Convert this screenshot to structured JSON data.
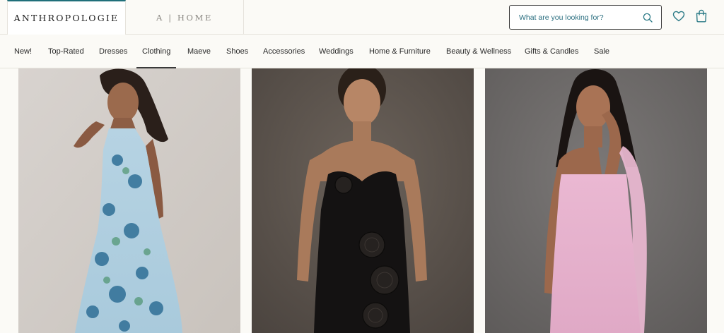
{
  "header": {
    "brand": "ANTHROPOLOGIE",
    "home_tab": "A | HOME",
    "search_placeholder": "What are you looking for?",
    "accent_color": "#1f6f7a"
  },
  "nav": {
    "items": [
      {
        "label": "New!"
      },
      {
        "label": "Top-Rated"
      },
      {
        "label": "Dresses"
      },
      {
        "label": "Clothing"
      },
      {
        "label": "Maeve"
      },
      {
        "label": "Shoes"
      },
      {
        "label": "Accessories"
      },
      {
        "label": "Weddings"
      },
      {
        "label": "Home & Furniture"
      },
      {
        "label": "Beauty & Wellness"
      },
      {
        "label": "Gifts & Candles"
      },
      {
        "label": "Sale"
      }
    ],
    "active_label": "Clothing"
  },
  "products": [
    {
      "image": "model in light blue floral halter maxi dress"
    },
    {
      "image": "model in black strapless dress with rosette appliqués"
    },
    {
      "image": "model in pink strapless dress with scarf"
    }
  ]
}
